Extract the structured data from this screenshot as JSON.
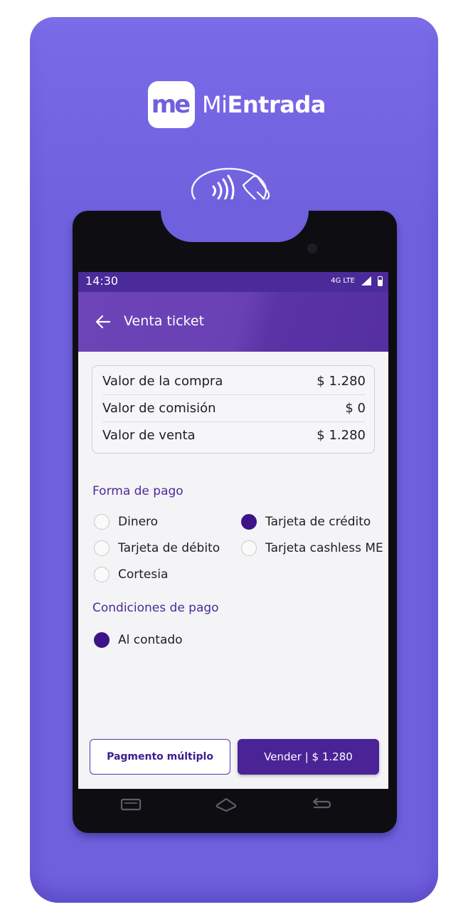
{
  "brand": {
    "badge": "me",
    "name_light": "Mi",
    "name_bold": "Entrada",
    "device_color": "#6f60de"
  },
  "statusbar": {
    "time": "14:30",
    "network": "4G LTE",
    "icons": [
      "signal-icon",
      "battery-icon"
    ]
  },
  "appbar": {
    "back_icon": "arrow-left-icon",
    "title": "Venta ticket",
    "color": "#4b2a99"
  },
  "summary": {
    "rows": [
      {
        "label": "Valor de la compra",
        "value": "$ 1.280"
      },
      {
        "label": "Valor de comisión",
        "value": "$ 0"
      },
      {
        "label": "Valor de venta",
        "value": "$ 1.280"
      }
    ]
  },
  "payment_method": {
    "title": "Forma de pago",
    "options": [
      {
        "label": "Dinero",
        "selected": false
      },
      {
        "label": "Tarjeta de crédito",
        "selected": true
      },
      {
        "label": "Tarjeta de débito",
        "selected": false
      },
      {
        "label": "Tarjeta cashless ME",
        "selected": false
      },
      {
        "label": "Cortesia",
        "selected": false
      }
    ]
  },
  "payment_conditions": {
    "title": "Condiciones de pago",
    "options": [
      {
        "label": "Al contado",
        "selected": true
      }
    ]
  },
  "actions": {
    "multiple_label": "Pagmento múltiplo",
    "sell_label": "Vender | $ 1.280"
  },
  "navbar": {
    "icons": [
      "recent-apps-icon",
      "home-icon",
      "back-nav-icon"
    ]
  }
}
